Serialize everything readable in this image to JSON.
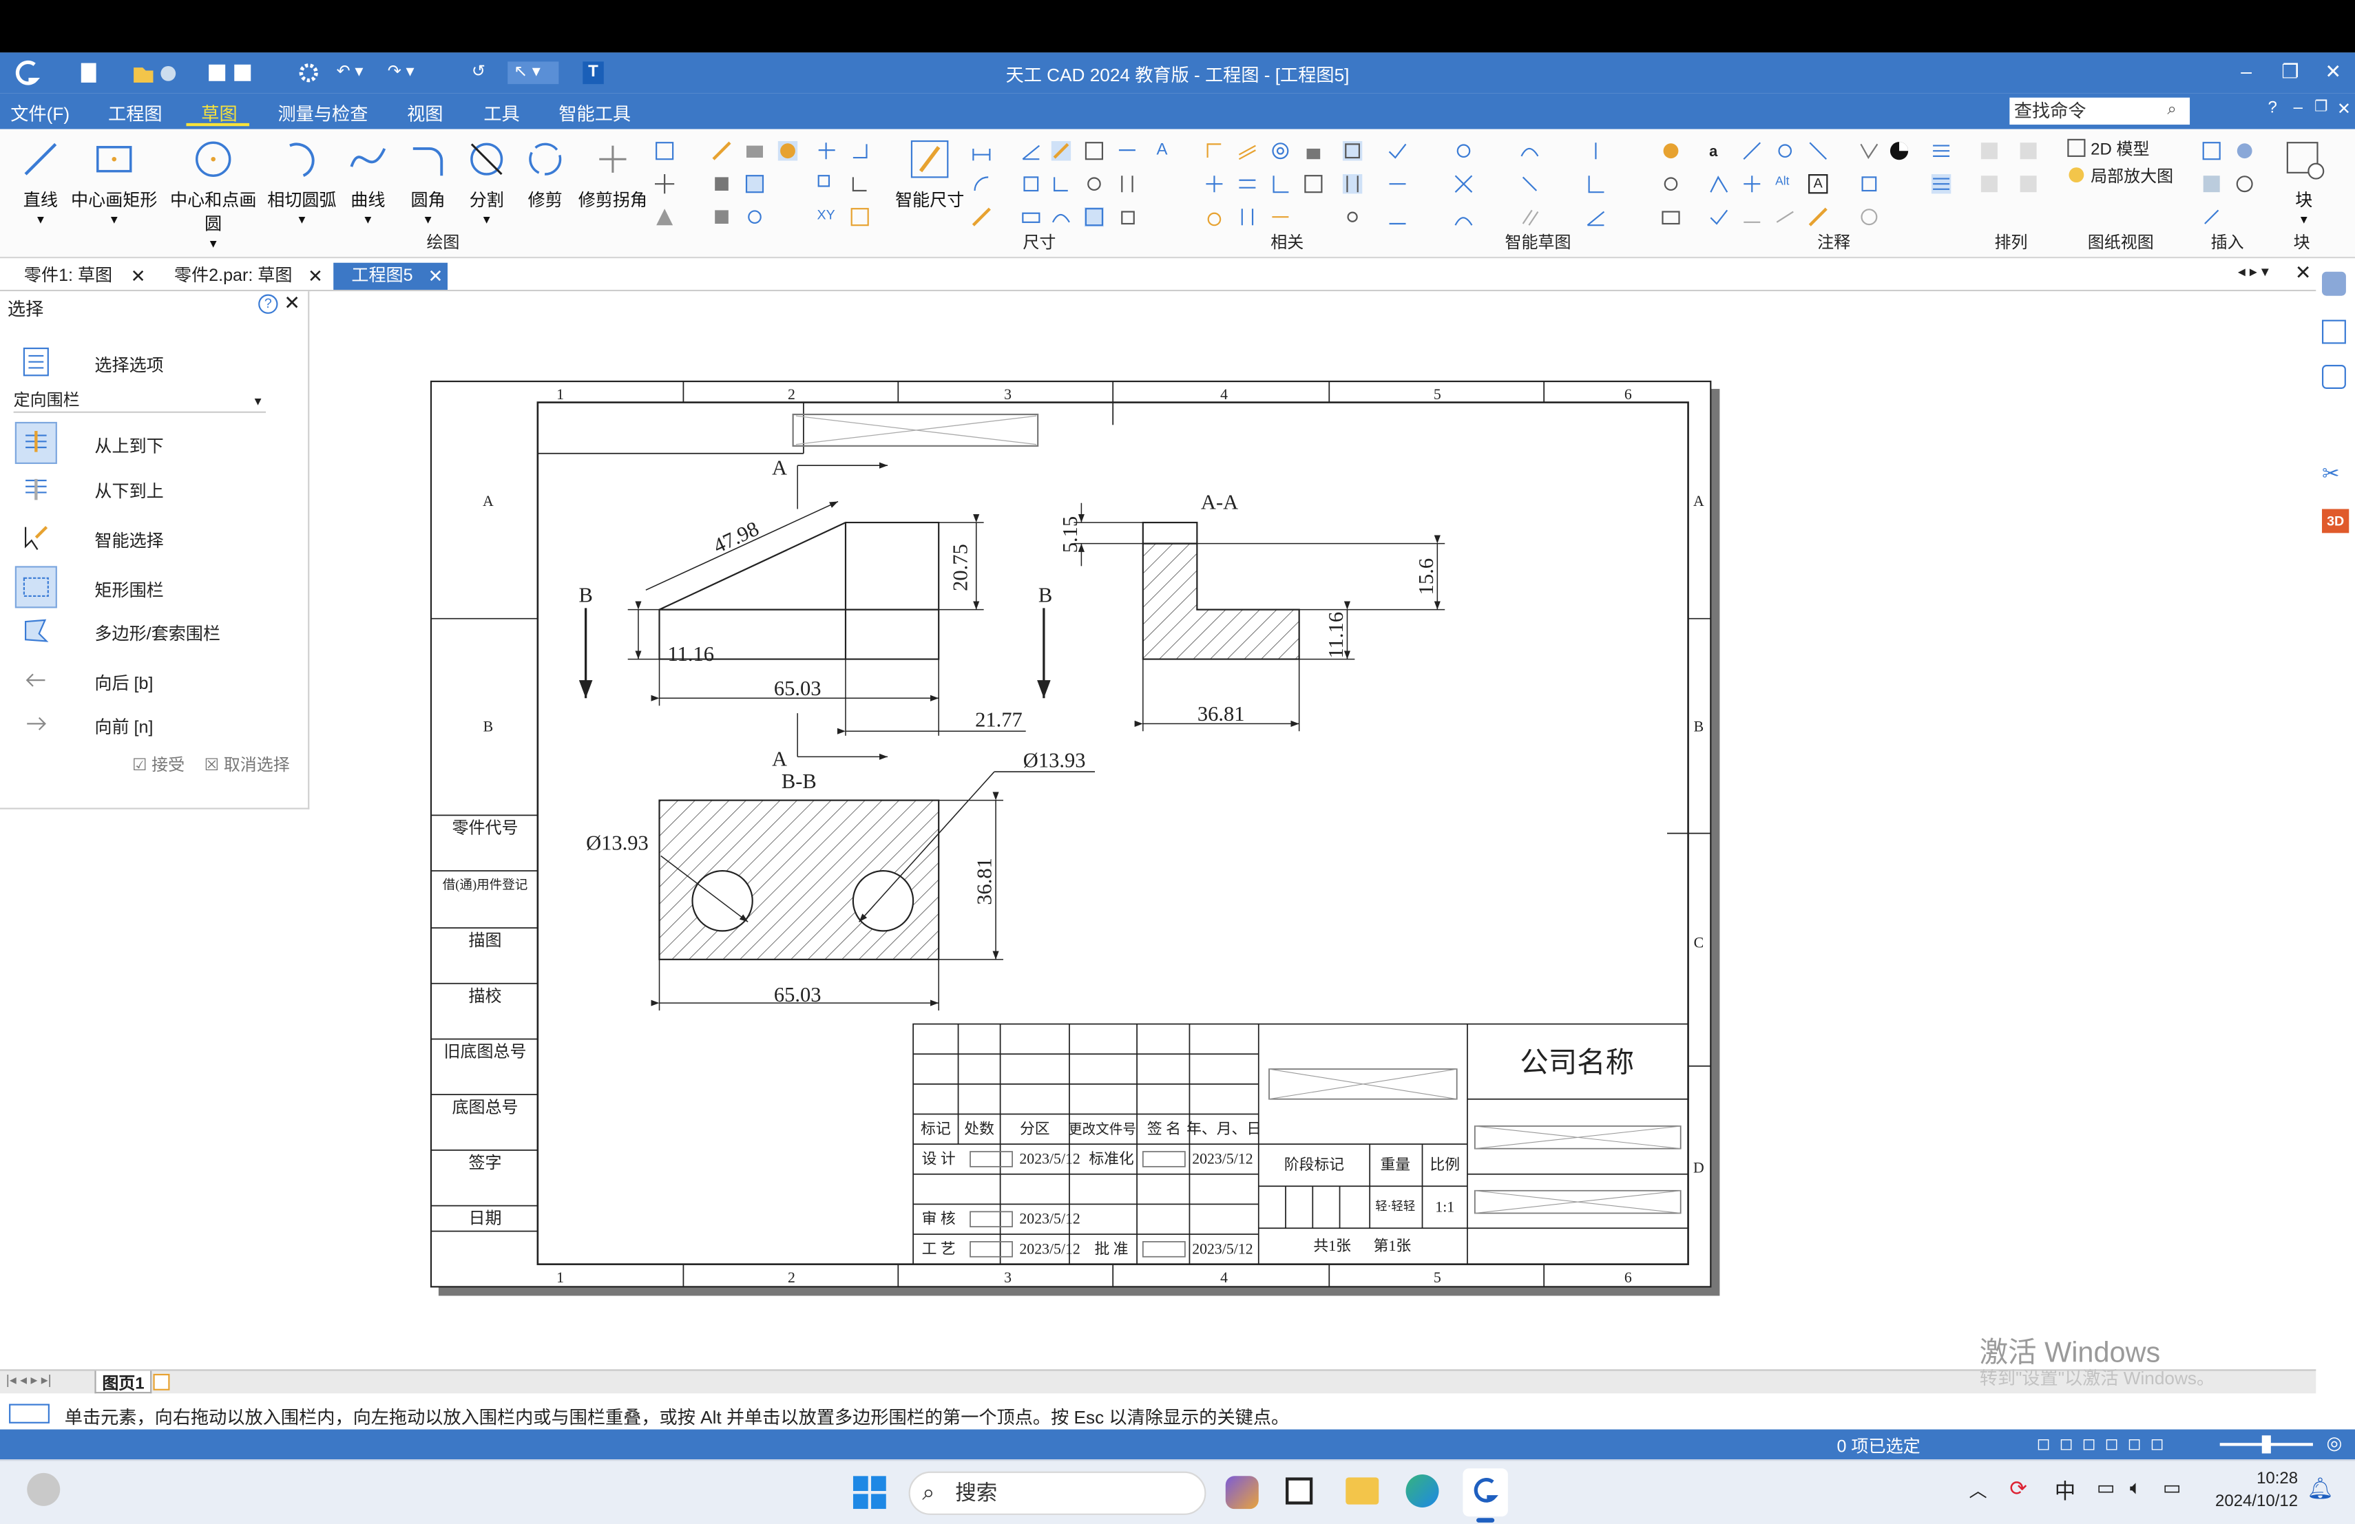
{
  "app": {
    "title": "天工 CAD 2024 教育版 - 工程图 - [工程图5]"
  },
  "menu": {
    "items": [
      "文件(F)",
      "工程图",
      "草图",
      "测量与检查",
      "视图",
      "工具",
      "智能工具"
    ],
    "active": "草图",
    "search_placeholder": "查找命令"
  },
  "ribbon": {
    "large_buttons": [
      "直线",
      "中心画矩形",
      "中心和点画圆",
      "相切圆弧",
      "曲线",
      "圆角",
      "分割",
      "修剪",
      "修剪拐角",
      "智能尺寸",
      "块"
    ],
    "groups": [
      "绘图",
      "尺寸",
      "相关",
      "智能草图",
      "注释",
      "排列",
      "图纸视图",
      "插入",
      "块"
    ],
    "view_options": [
      "2D 模型",
      "局部放大图"
    ]
  },
  "doc_tabs": [
    {
      "label": "零件1: 草图",
      "active": false
    },
    {
      "label": "零件2.par: 草图",
      "active": false
    },
    {
      "label": "工程图5",
      "active": true
    }
  ],
  "select_panel": {
    "title": "选择",
    "options_label": "选择选项",
    "mode_value": "定向围栏",
    "items": [
      "从上到下",
      "从下到上",
      "智能选择",
      "矩形围栏",
      "多边形/套索围栏",
      "向后 [b]",
      "向前 [n]"
    ],
    "accept": "接受",
    "cancel": "取消选择"
  },
  "drawing": {
    "col_labels": [
      "1",
      "2",
      "3",
      "4",
      "5",
      "6"
    ],
    "row_labels": [
      "A",
      "B",
      "C",
      "D"
    ],
    "left_column": [
      "零件代号",
      "借(通)用件登记",
      "描图",
      "描校",
      "旧底图总号",
      "底图总号",
      "签字",
      "日期"
    ],
    "dims": {
      "slope": "47.98",
      "height_main": "20.75",
      "height_low": "11.16",
      "width_main": "65.03",
      "offset": "21.77",
      "aa_top": "5.15",
      "aa_height": "15.6",
      "aa_low": "11.16",
      "aa_width": "36.81",
      "hole_dia_1": "Ø13.93",
      "hole_dia_2": "Ø13.93",
      "bb_height": "36.81",
      "bb_width": "65.03"
    },
    "section_marks": {
      "a": "A",
      "b": "B",
      "aa": "A-A",
      "bb": "B-B"
    },
    "title_block": {
      "company": "公司名称",
      "headers": [
        "标记",
        "处数",
        "分区",
        "更改文件号",
        "签 名",
        "年、月、日"
      ],
      "rows": [
        {
          "label": "设  计",
          "date": "2023/5/12",
          "role": "标准化",
          "date2": "2023/5/12"
        },
        {
          "label": "审  核",
          "date": "2023/5/12"
        },
        {
          "label": "工  艺",
          "date": "2023/5/12",
          "role": "批  准",
          "date2": "2023/5/12"
        }
      ],
      "stage": "阶段标记",
      "weight": "重量",
      "scale_label": "比例",
      "scale_value": "1:1",
      "weight_value": "轻·轻轻",
      "sheets_total": "共1张",
      "sheet_num": "第1张"
    }
  },
  "sheet_tab": "图页1",
  "prompt": "单击元素，向右拖动以放入围栏内，向左拖动以放入围栏内或与围栏重叠，或按 Alt 并单击以放置多边形围栏的第一个顶点。按 Esc 以清除显示的关键点。",
  "status": {
    "selection": "0 项已选定"
  },
  "watermark": {
    "line1": "激活 Windows",
    "line2": "转到\"设置\"以激活 Windows。"
  },
  "taskbar": {
    "search": "搜索",
    "ime": "中",
    "time": "10:28",
    "date": "2024/10/12"
  },
  "colors": {
    "titlebar": "#3c78c6",
    "accent_menu": "#f7e23a",
    "statusbar": "#3c78c6"
  }
}
